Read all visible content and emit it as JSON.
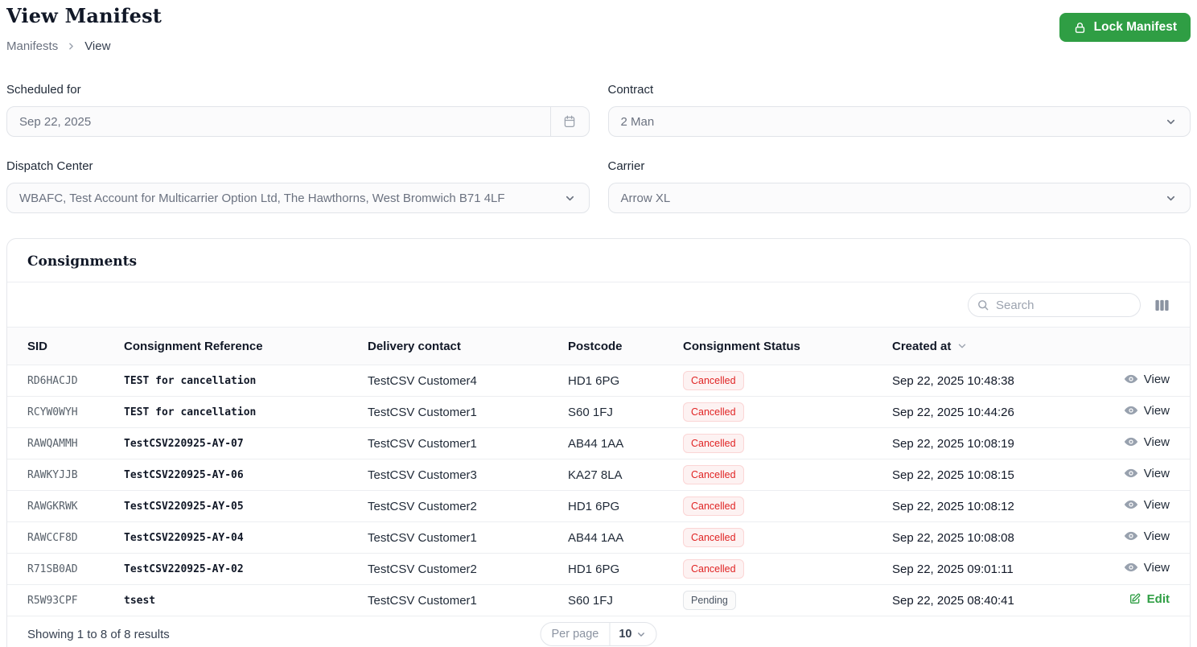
{
  "page": {
    "title": "View Manifest",
    "breadcrumb": {
      "items": [
        "Manifests",
        "View"
      ]
    },
    "lock_button_label": "Lock Manifest"
  },
  "form": {
    "scheduled_for": {
      "label": "Scheduled for",
      "value": "Sep 22, 2025"
    },
    "contract": {
      "label": "Contract",
      "value": "2 Man"
    },
    "dispatch_center": {
      "label": "Dispatch Center",
      "value": "WBAFC, Test Account for Multicarrier Option Ltd, The Hawthorns, West Bromwich B71 4LF"
    },
    "carrier": {
      "label": "Carrier",
      "value": "Arrow XL"
    }
  },
  "consignments": {
    "title": "Consignments",
    "search_placeholder": "Search",
    "columns": [
      "SID",
      "Consignment Reference",
      "Delivery contact",
      "Postcode",
      "Consignment Status",
      "Created at"
    ],
    "sorted_by": "Created at",
    "rows": [
      {
        "sid": "RD6HACJD",
        "reference": "TEST for cancellation",
        "contact": "TestCSV Customer4",
        "postcode": "HD1 6PG",
        "status": "Cancelled",
        "created_at": "Sep 22, 2025 10:48:38",
        "action": "View"
      },
      {
        "sid": "RCYW0WYH",
        "reference": "TEST for cancellation",
        "contact": "TestCSV Customer1",
        "postcode": "S60 1FJ",
        "status": "Cancelled",
        "created_at": "Sep 22, 2025 10:44:26",
        "action": "View"
      },
      {
        "sid": "RAWQAMMH",
        "reference": "TestCSV220925-AY-07",
        "contact": "TestCSV Customer1",
        "postcode": "AB44 1AA",
        "status": "Cancelled",
        "created_at": "Sep 22, 2025 10:08:19",
        "action": "View"
      },
      {
        "sid": "RAWKYJJB",
        "reference": "TestCSV220925-AY-06",
        "contact": "TestCSV Customer3",
        "postcode": "KA27 8LA",
        "status": "Cancelled",
        "created_at": "Sep 22, 2025 10:08:15",
        "action": "View"
      },
      {
        "sid": "RAWGKRWK",
        "reference": "TestCSV220925-AY-05",
        "contact": "TestCSV Customer2",
        "postcode": "HD1 6PG",
        "status": "Cancelled",
        "created_at": "Sep 22, 2025 10:08:12",
        "action": "View"
      },
      {
        "sid": "RAWCCF8D",
        "reference": "TestCSV220925-AY-04",
        "contact": "TestCSV Customer1",
        "postcode": "AB44 1AA",
        "status": "Cancelled",
        "created_at": "Sep 22, 2025 10:08:08",
        "action": "View"
      },
      {
        "sid": "R71SB0AD",
        "reference": "TestCSV220925-AY-02",
        "contact": "TestCSV Customer2",
        "postcode": "HD1 6PG",
        "status": "Cancelled",
        "created_at": "Sep 22, 2025 09:01:11",
        "action": "View"
      },
      {
        "sid": "R5W93CPF",
        "reference": "tsest",
        "contact": "TestCSV Customer1",
        "postcode": "S60 1FJ",
        "status": "Pending",
        "created_at": "Sep 22, 2025 08:40:41",
        "action": "Edit"
      }
    ],
    "status_styles": {
      "Cancelled": {
        "text": "#e02424",
        "bg": "#fdf2f2",
        "border": "#fbd5d5"
      },
      "Pending": {
        "text": "#4b5563",
        "bg": "#fbfbfb",
        "border": "#e2e5e9"
      }
    },
    "footer": {
      "summary": "Showing 1 to 8 of 8 results",
      "per_page_label": "Per page",
      "per_page_value": "10"
    }
  },
  "colors": {
    "accent_green": "#2f9e44",
    "edit_link_green": "#2f9e44",
    "cancelled_red": "#e02424"
  }
}
